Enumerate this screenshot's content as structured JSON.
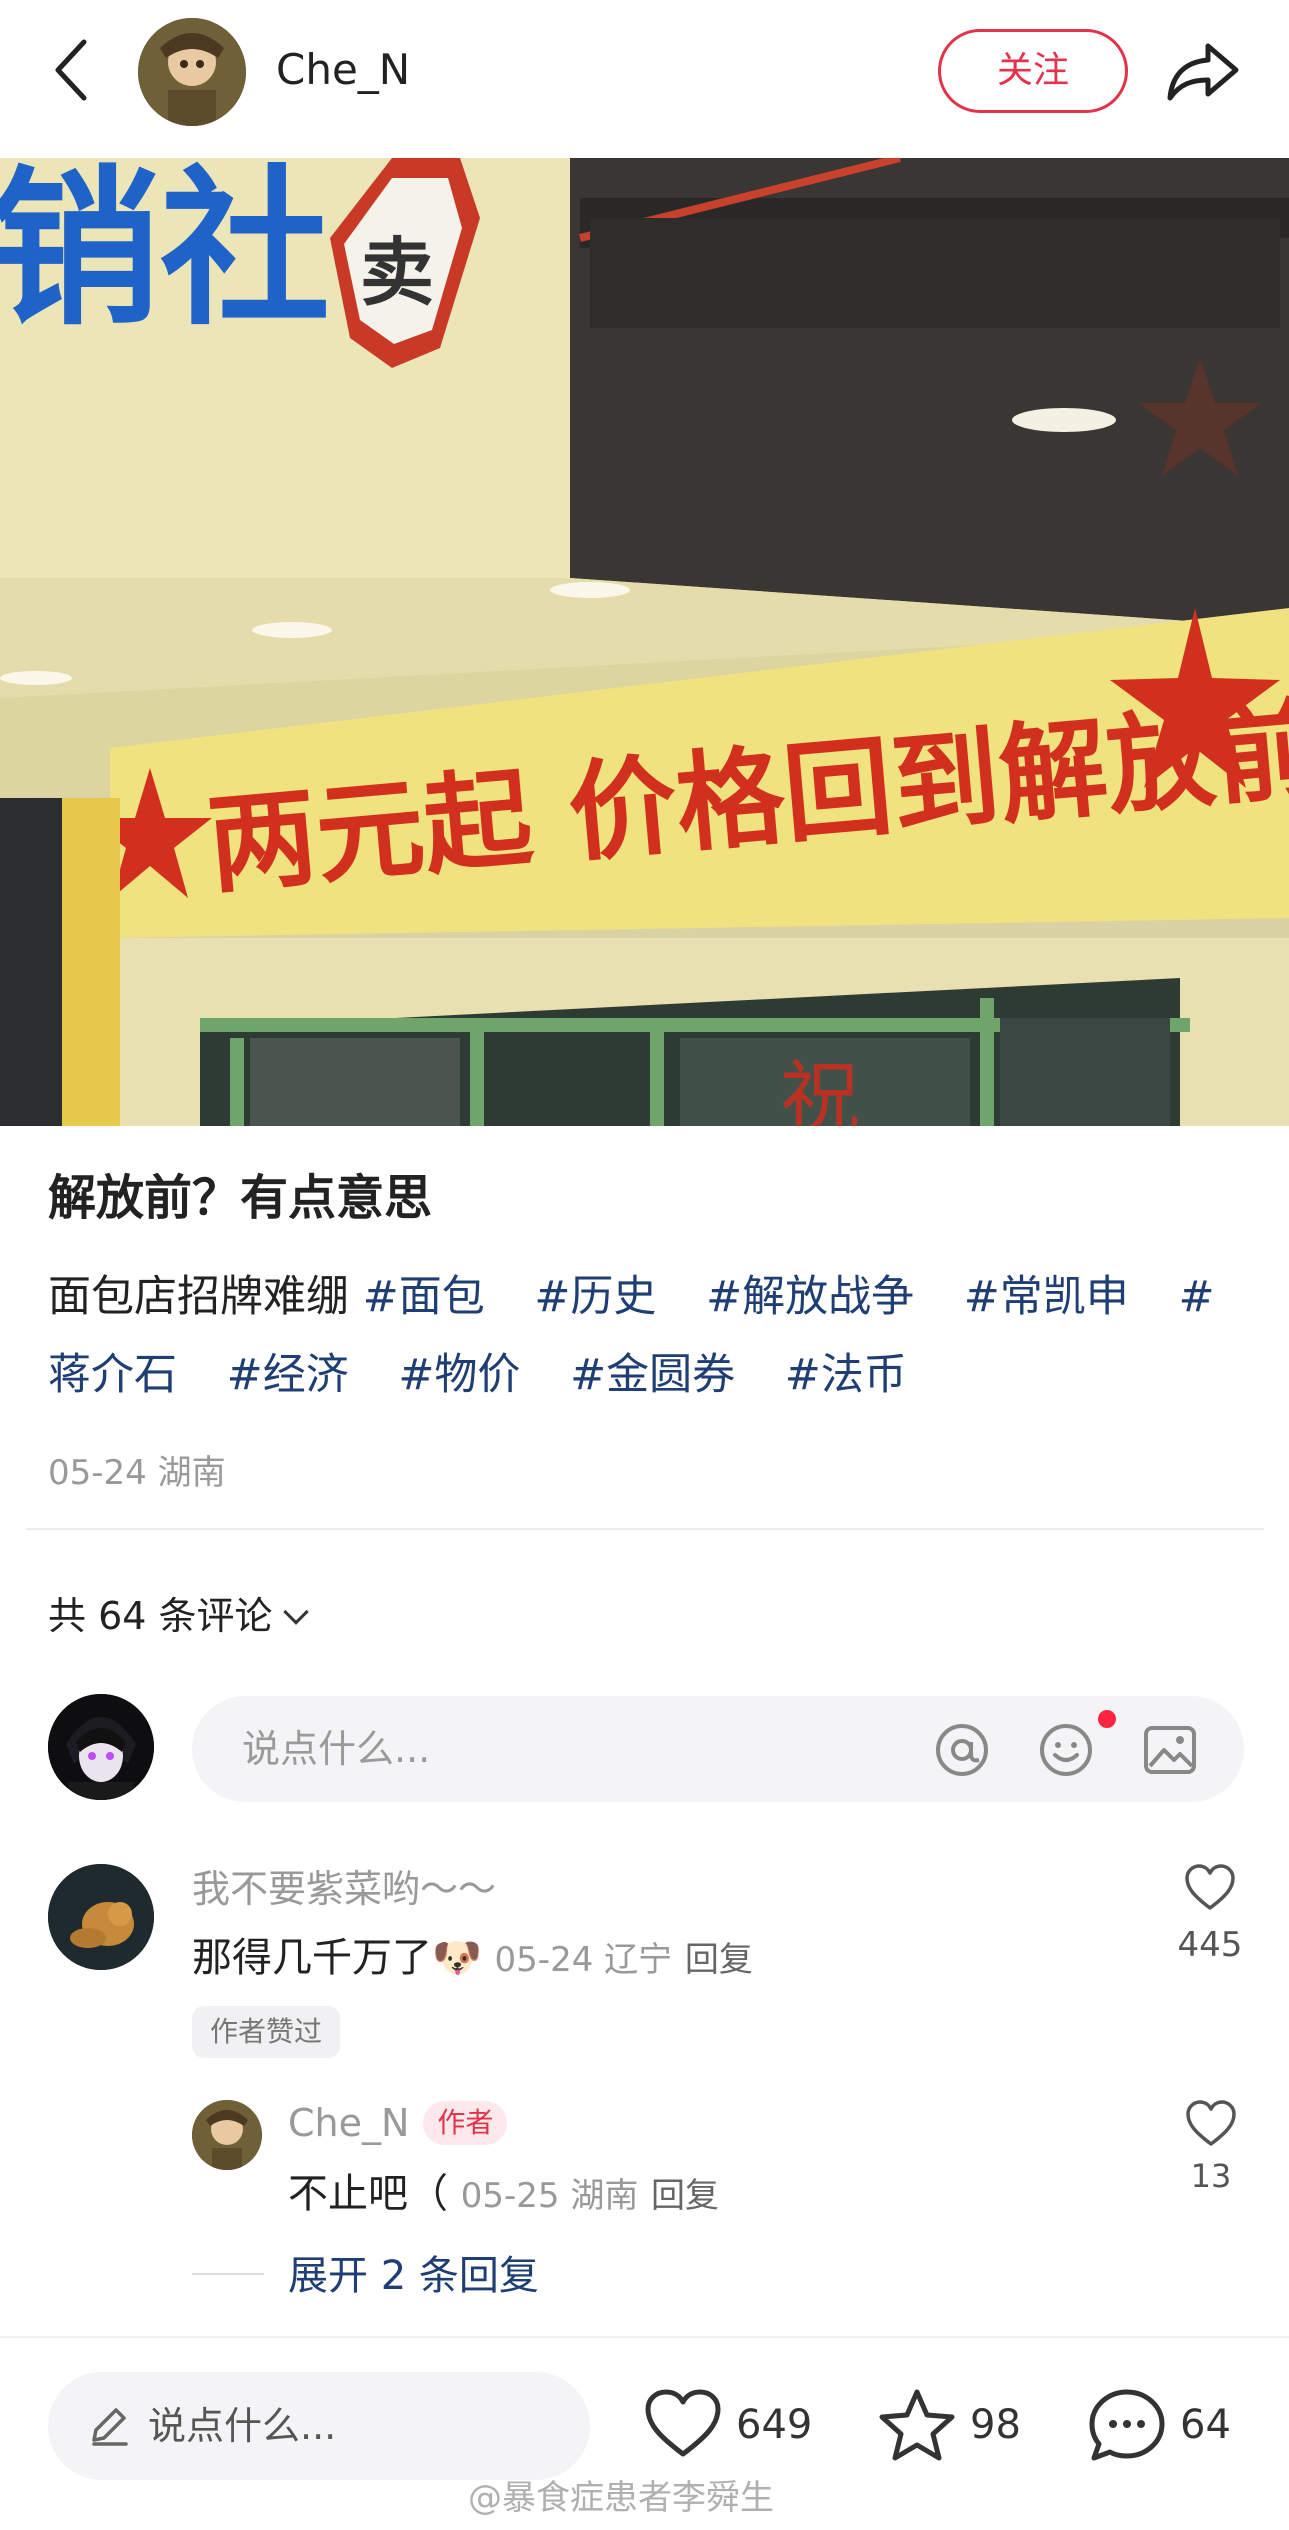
{
  "header": {
    "username": "Che_N",
    "follow_label": "关注"
  },
  "post": {
    "image_sign_text": "两元起 价格回到解放前",
    "image_top_sign": "销社",
    "image_badge": "卖",
    "title": "解放前？有点意思",
    "body_text": "面包店招牌难绷",
    "tags": [
      "#面包",
      "#历史",
      "#解放战争",
      "#常凯申",
      "#蒋介石",
      "#经济",
      "#物价",
      "#金圆券",
      "#法币"
    ],
    "meta": "05-24 湖南"
  },
  "comments_header": {
    "label": "共 64 条评论"
  },
  "comment_input": {
    "placeholder": "说点什么..."
  },
  "comments": [
    {
      "user": "我不要紫菜哟～～",
      "text": "那得几千万了",
      "emoji": "🐶",
      "meta": "05-24 辽宁",
      "reply_label": "回复",
      "likes": "445",
      "author_liked": "作者赞过",
      "reply": {
        "user": "Che_N",
        "badge": "作者",
        "text": "不止吧（",
        "meta": "05-25 湖南",
        "reply_label": "回复",
        "likes": "13"
      },
      "expand_label": "展开 2 条回复"
    }
  ],
  "bottom_bar": {
    "placeholder": "说点什么...",
    "likes": "649",
    "favorites": "98",
    "comments": "64"
  },
  "watermark": "@暴食症患者李舜生",
  "colors": {
    "accent": "#e2334a",
    "tag": "#1f3f74",
    "sign_red": "#d2301e",
    "sign_yellow": "#f0e27e"
  }
}
